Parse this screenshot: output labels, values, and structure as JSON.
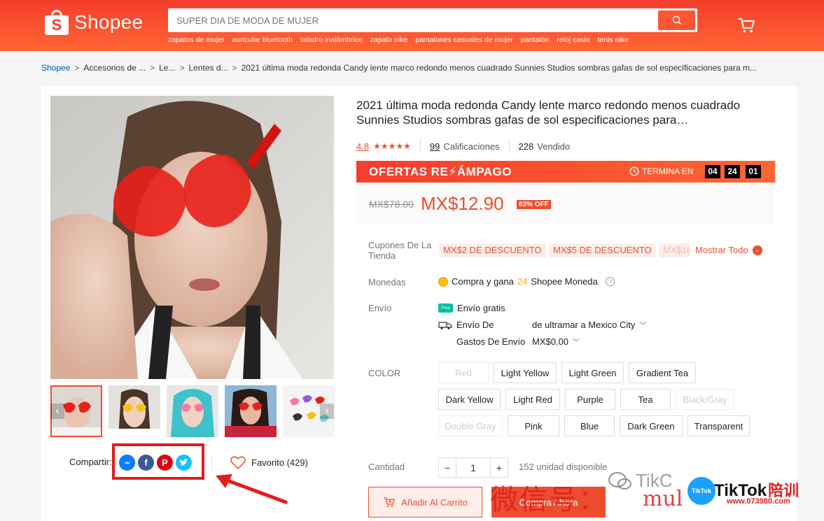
{
  "header": {
    "logo_text": "Shopee",
    "search_placeholder": "SUPER DIA DE MODA DE MUJER",
    "hints": [
      "zapatos de mujer",
      "auricular bluetooth",
      "taladro inalámbrico",
      "zapato nike",
      "pantalones casuales de mujer",
      "pantalón",
      "reloj casio",
      "tenis nike"
    ]
  },
  "breadcrumb": {
    "items": [
      "Shopee",
      "Accesorios de ...",
      "Le...",
      "Lentes d...",
      "2021 última moda redonda Candy lente marco redondo menos cuadrado Sunnies Studios sombras gafas de sol especificaciones para m..."
    ],
    "separator": ">"
  },
  "product": {
    "title": "2021 última moda redonda Candy lente marco redondo menos cuadrado Sunnies Studios sombras gafas de sol especificaciones para…",
    "rating": "4.8",
    "stars": "★★★★★",
    "ratings_count": "99",
    "ratings_label": "Calificaciones",
    "sold_count": "228",
    "sold_label": "Vendido"
  },
  "flash": {
    "title": "OFERTAS RE",
    "title_end": "ÁMPAGO",
    "ends_label": "TERMINA EN",
    "timer": [
      "04",
      "24",
      "01"
    ]
  },
  "price": {
    "original": "MX$78.00",
    "current": "MX$12.90",
    "discount": "83% OFF"
  },
  "coupons": {
    "label": "Cupones De La Tienda",
    "items": [
      "MX$2 DE DESCUENTO",
      "MX$5 DE DESCUENTO",
      "MX$1("
    ],
    "show_all": "Mostrar Todo"
  },
  "coins": {
    "label": "Monedas",
    "text_before": "Compra y gana",
    "amount": "24",
    "text_after": "Shopee Moneda"
  },
  "shipping": {
    "label": "Envío",
    "free": "Envío gratis",
    "free_badge": "Free",
    "from_label": "Envío De",
    "from_value": "de ultramar a Mexico City",
    "cost_label": "Gastos De Envío",
    "cost_value": "MX$0.00"
  },
  "color": {
    "label": "COLOR",
    "options": [
      "Red",
      "Light Yellow",
      "Light Green",
      "Gradient Tea",
      "Dark Yellow",
      "Light Red",
      "Purple",
      "Tea",
      "Black/Gray",
      "Double Gray",
      "Pink",
      "Blue",
      "Dark Green",
      "Transparent"
    ],
    "disabled": [
      "Red",
      "Black/Gray",
      "Double Gray"
    ]
  },
  "quantity": {
    "label": "Cantidad",
    "value": "1",
    "minus": "−",
    "plus": "+",
    "stock": "152 unidad disponible"
  },
  "actions": {
    "add_to_cart": "Añadir Al Carrito",
    "buy_now": "Compra Ahora"
  },
  "social": {
    "share_label": "Compartir:",
    "favorite_label": "Favorito (429)"
  },
  "watermark": {
    "wechat": "微信号：",
    "id": "mul",
    "partial": "TikC",
    "brand": "TikTok",
    "brand_suffix": "陪训",
    "url": "www.073980.com"
  },
  "colors": {
    "primary": "#ee4d2d",
    "header_start": "#f53d2d",
    "header_end": "#ff6633",
    "highlight": "#e41c1c"
  }
}
